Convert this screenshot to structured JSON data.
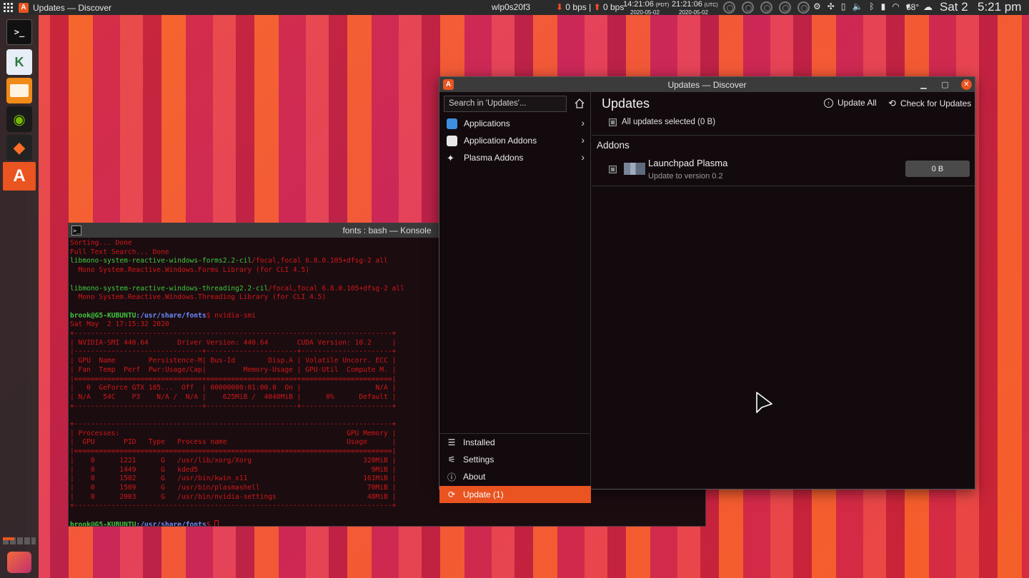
{
  "top_panel": {
    "active_title": "Updates — Discover",
    "network_interface": "wlp0s20f3",
    "download_speed": "0 bps",
    "upload_speed": "0 bps",
    "clock_local_time": "14:21:06",
    "clock_local_zone": "(PDT)",
    "clock_local_date": "2020-05-02",
    "clock_utc_time": "21:21:06",
    "clock_utc_zone": "(UTC)",
    "clock_utc_date": "2020-05-02",
    "temperature": "68°",
    "day": "Sat 2",
    "time": "5:21 pm"
  },
  "dock": {
    "items": [
      "terminal",
      "kate",
      "files",
      "nvidia-settings",
      "gitlab",
      "discover"
    ]
  },
  "konsole": {
    "title": "fonts : bash — Konsole",
    "prompt_user": "brook@G5-KUBUNTU",
    "prompt_path": ":/usr/share/fonts",
    "command": "$ nvidia-smi",
    "lines": {
      "l1": "Sorting... Done",
      "l2": "Full Text Search... Done",
      "l3_pkg": "libmono-system-reactive-windows-forms2.2-cil",
      "l3_rest": "/focal,focal 6.8.0.105+dfsg-2 all",
      "l4": "  Mono System.Reactive.Windows.Forms Library (for CLI 4.5)",
      "l6_pkg": "libmono-system-reactive-windows-threading2.2-cil",
      "l6_rest": "/focal,focal 6.8.0.105+dfsg-2 all",
      "l7": "  Mono System.Reactive.Windows.Threading Library (for CLI 4.5)",
      "date": "Sat May  2 17:15:32 2020",
      "smi1": "+-----------------------------------------------------------------------------+",
      "smi2": "| NVIDIA-SMI 440.64       Driver Version: 440.64       CUDA Version: 10.2     |",
      "smi3": "|-------------------------------+----------------------+----------------------+",
      "smi4": "| GPU  Name        Persistence-M| Bus-Id        Disp.A | Volatile Uncorr. ECC |",
      "smi5": "| Fan  Temp  Perf  Pwr:Usage/Cap|         Memory-Usage | GPU-Util  Compute M. |",
      "smi6": "|===============================+======================+======================|",
      "smi7": "|   0  GeForce GTX 105...  Off  | 00000000:01:00.0  On |                  N/A |",
      "smi8": "| N/A   54C    P3    N/A /  N/A |    625MiB /  4040MiB |      0%      Default |",
      "smi9": "+-------------------------------+----------------------+----------------------+",
      "smi10": "                                                                               ",
      "smi11": "+-----------------------------------------------------------------------------+",
      "smi12": "| Processes:                                                       GPU Memory |",
      "smi13": "|  GPU       PID   Type   Process name                             Usage      |",
      "smi14": "|=============================================================================|",
      "smi15": "|    0      1221      G   /usr/lib/xorg/Xorg                           320MiB |",
      "smi16": "|    0      1449      G   kded5                                          9MiB |",
      "smi17": "|    0      1502      G   /usr/bin/kwin_x11                            161MiB |",
      "smi18": "|    0      1509      G   /usr/bin/plasmashell                          70MiB |",
      "smi19": "|    0      2003      G   /usr/bin/nvidia-settings                      48MiB |",
      "smi20": "+-----------------------------------------------------------------------------+",
      "prompt_end": "$ "
    }
  },
  "discover": {
    "title": "Updates — Discover",
    "search_placeholder": "Search in 'Updates'...",
    "categories": [
      {
        "label": "Applications",
        "color": "#3d8fe0"
      },
      {
        "label": "Application Addons",
        "color": "#e8e8e8"
      },
      {
        "label": "Plasma Addons",
        "color": "#e8e8e8"
      }
    ],
    "nav": [
      {
        "label": "Installed",
        "icon": "☰"
      },
      {
        "label": "Settings",
        "icon": "⚟"
      },
      {
        "label": "About",
        "icon": "ⓘ"
      },
      {
        "label": "Update (1)",
        "icon": "⟳"
      }
    ],
    "heading": "Updates",
    "update_all_label": "Update All",
    "check_updates_label": "Check for Updates",
    "all_selected_label": "All updates selected (0 B)",
    "section_label": "Addons",
    "update_item": {
      "name": "Launchpad Plasma",
      "subtitle": "Update to version 0.2",
      "size": "0 B"
    }
  }
}
